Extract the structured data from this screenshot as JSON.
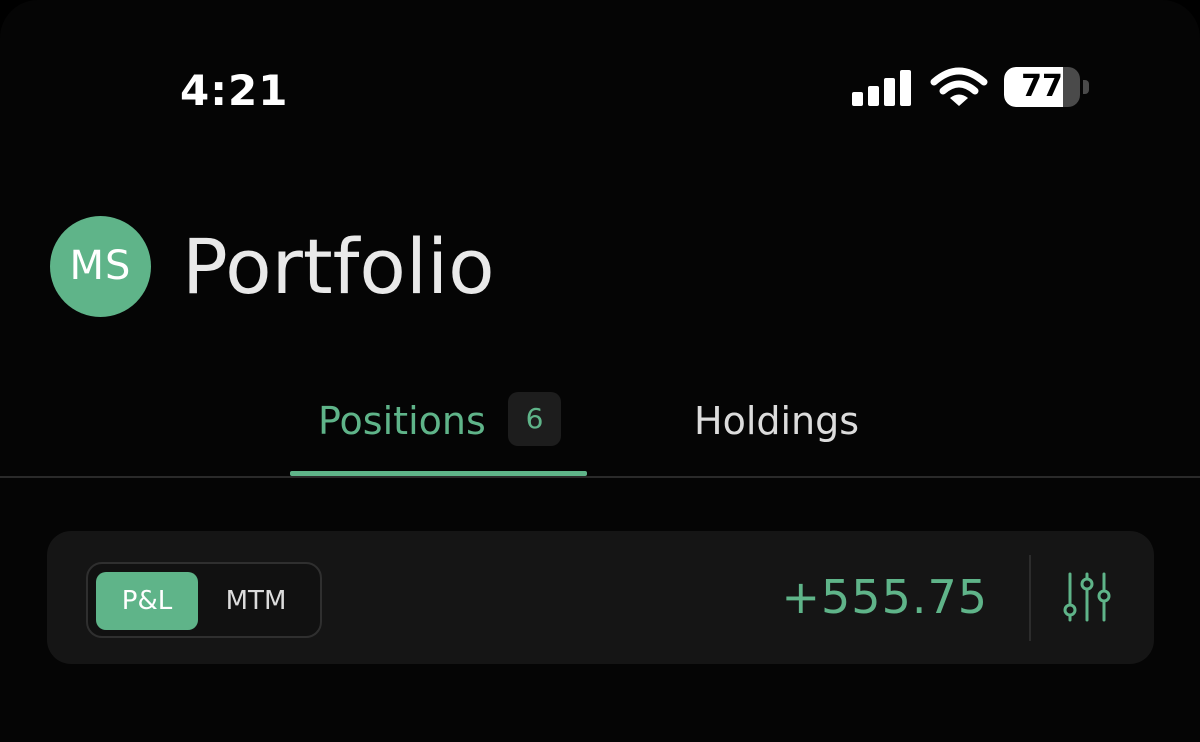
{
  "status_bar": {
    "time": "4:21",
    "battery": "77",
    "battery_level": 0.77,
    "icons": [
      "signal-icon",
      "wifi-icon",
      "battery-icon"
    ]
  },
  "header": {
    "avatar_initials": "MS",
    "title": "Portfolio"
  },
  "tabs": [
    {
      "label": "Positions",
      "badge": "6",
      "active": true
    },
    {
      "label": "Holdings",
      "active": false
    }
  ],
  "pnl_card": {
    "toggle": {
      "options": [
        "P&L",
        "MTM"
      ],
      "selected": "P&L"
    },
    "value": "+555.75",
    "filter_icon": "sliders-icon"
  },
  "colors": {
    "accent": "#5fb489",
    "background": "#050505",
    "card": "#151515"
  }
}
